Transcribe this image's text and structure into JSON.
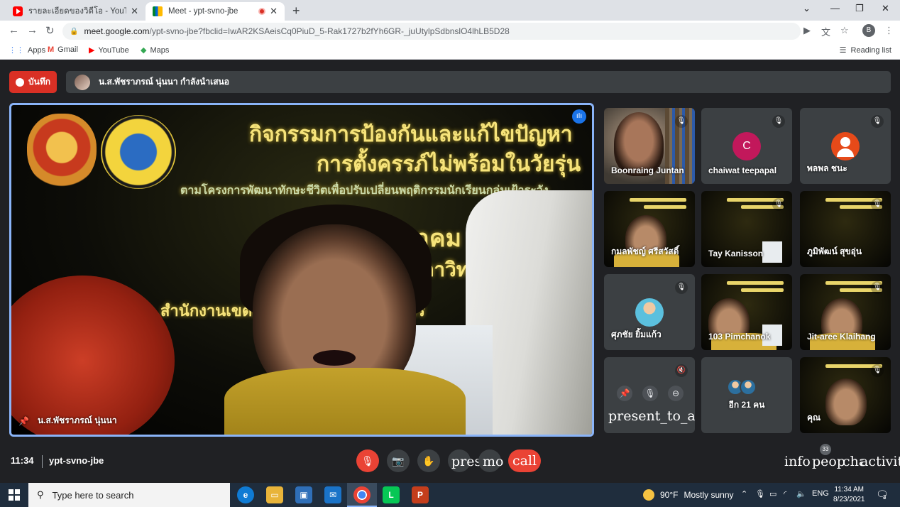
{
  "browser": {
    "tabs": [
      {
        "title": "รายละเอียดของวิดีโอ - YouTube Studio"
      },
      {
        "title": "Meet - ypt-svno-jbe"
      }
    ],
    "url_host": "meet.google.com",
    "url_path": "/ypt-svno-jbe?fbclid=IwAR2KSAeisCq0PiuD_5-Rak1727b2fYh6GR-_juUtylpSdbnslO4lhLB5D28",
    "profile_initial": "B",
    "bookmarks": [
      "Apps",
      "Gmail",
      "YouTube",
      "Maps"
    ],
    "reading_list": "Reading list"
  },
  "meet": {
    "record_label": "บันทึก",
    "presenting_text": "น.ส.พัชราภรณ์ นุ่นนา กำลังนำเสนอ",
    "main_speaker": "น.ส.พัชราภรณ์ นุ่นนา",
    "slide": {
      "line1": "กิจกรรมการป้องกันและแก้ไขปัญหา",
      "line2": "การตั้งครรภ์ไม่พร้อมในวัยรุ่น",
      "line3": "ตามโครงการพัฒนาทักษะชีวิตเพื่อปรับเปลี่ยนพฤติกรรมนักเรียนกลุ่มเฝ้าระวัง",
      "line4": "สิงหาคม ๒๕๖๔",
      "line5": "ชประภาวิทยาคม",
      "line6": "สำนักงานเขตพื้นที่                 าสุราษฎร์ธานี ชุมพร"
    },
    "participants": [
      {
        "name": "Boonraing Juntan"
      },
      {
        "name": "chaiwat teepapal",
        "initial": "C"
      },
      {
        "name": "พลพล ชนะ"
      },
      {
        "name": "กมลพัชญ์ ศรีสวัสดิ์"
      },
      {
        "name": "Tay Kanisson"
      },
      {
        "name": "ภูมิพัฒน์ สุขอุ่น"
      },
      {
        "name": "ศุภชัย ยิ้มแก้ว"
      },
      {
        "name": "103 Pimchanok"
      },
      {
        "name": "Jit-aree Klaihang"
      },
      {
        "name": "คุณ"
      }
    ],
    "self_tile_text": "present_to_all",
    "more_count": "อีก 21 คน",
    "meeting_time": "11:34",
    "meeting_code": "ypt-svno-jbe",
    "controls": {
      "present_text": "presc",
      "more_text": "mo",
      "end_call": "call",
      "info": "info",
      "people": "people",
      "chat": "chat",
      "activities": "activities",
      "people_count": "33"
    }
  },
  "taskbar": {
    "search_placeholder": "Type here to search",
    "weather_temp": "90°F",
    "weather_desc": "Mostly sunny",
    "lang": "ENG",
    "clock_time": "11:34 AM",
    "clock_date": "8/23/2021",
    "notifications": "3"
  }
}
